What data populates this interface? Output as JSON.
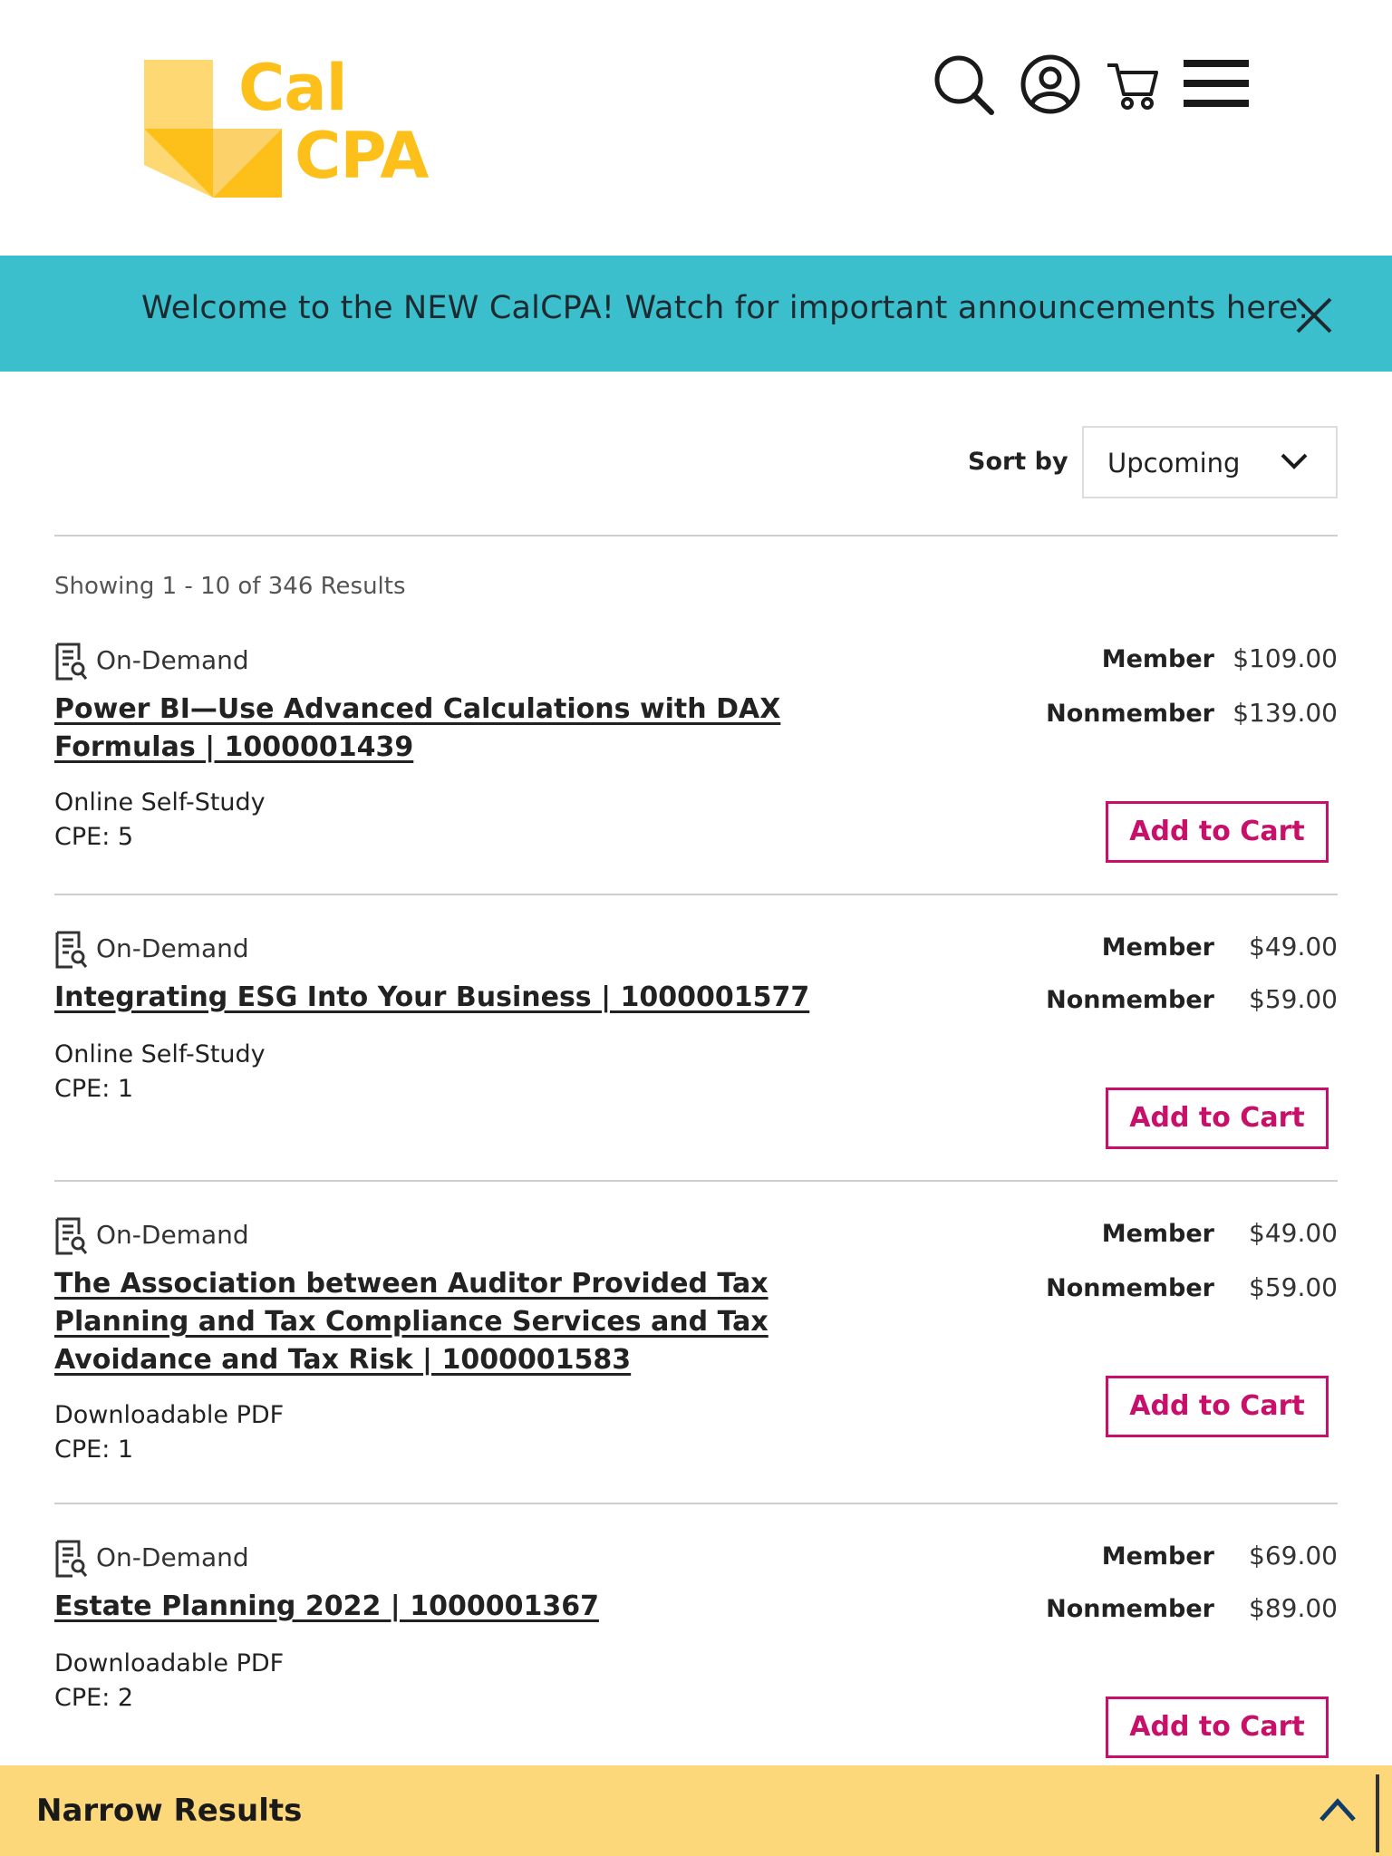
{
  "header": {
    "logo_line1": "Cal",
    "logo_line2": "CPA",
    "icons": [
      "search-icon",
      "user-icon",
      "cart-icon",
      "menu-icon"
    ]
  },
  "announcement": {
    "text": "Welcome to the NEW CalCPA! Watch for important announcements here."
  },
  "sort": {
    "label": "Sort by",
    "selected": "Upcoming"
  },
  "results": {
    "summary": "Showing 1 - 10 of 346 Results"
  },
  "courses": [
    {
      "type": "On-Demand",
      "title": "Power BI—Use Advanced Calculations with DAX Formulas | 1000001439",
      "format": "Online Self-Study",
      "cpe": "CPE: 5",
      "member_label": "Member",
      "member_price": "$109.00",
      "nonmember_label": "Nonmember",
      "nonmember_price": "$139.00",
      "button": "Add to Cart"
    },
    {
      "type": "On-Demand",
      "title": "Integrating ESG Into Your Business | 1000001577",
      "format": "Online Self-Study",
      "cpe": "CPE: 1",
      "member_label": "Member",
      "member_price": "$49.00",
      "nonmember_label": "Nonmember",
      "nonmember_price": "$59.00",
      "button": "Add to Cart"
    },
    {
      "type": "On-Demand",
      "title": "The Association between Auditor Provided Tax Planning and Tax Compliance Services and Tax Avoidance and Tax Risk | 1000001583",
      "format": "Downloadable PDF",
      "cpe": "CPE: 1",
      "member_label": "Member",
      "member_price": "$49.00",
      "nonmember_label": "Nonmember",
      "nonmember_price": "$59.00",
      "button": "Add to Cart"
    },
    {
      "type": "On-Demand",
      "title": "Estate Planning 2022 | 1000001367",
      "format": "Downloadable PDF",
      "cpe": "CPE: 2",
      "member_label": "Member",
      "member_price": "$69.00",
      "nonmember_label": "Nonmember",
      "nonmember_price": "$89.00",
      "button": "Add to Cart"
    }
  ],
  "narrow": {
    "title": "Narrow Results"
  },
  "colors": {
    "logo_yellow": "#fdc01a",
    "announcement_bg": "#3bbfcd",
    "accent_magenta": "#c8106b",
    "footer_bg": "#fdd87b"
  }
}
